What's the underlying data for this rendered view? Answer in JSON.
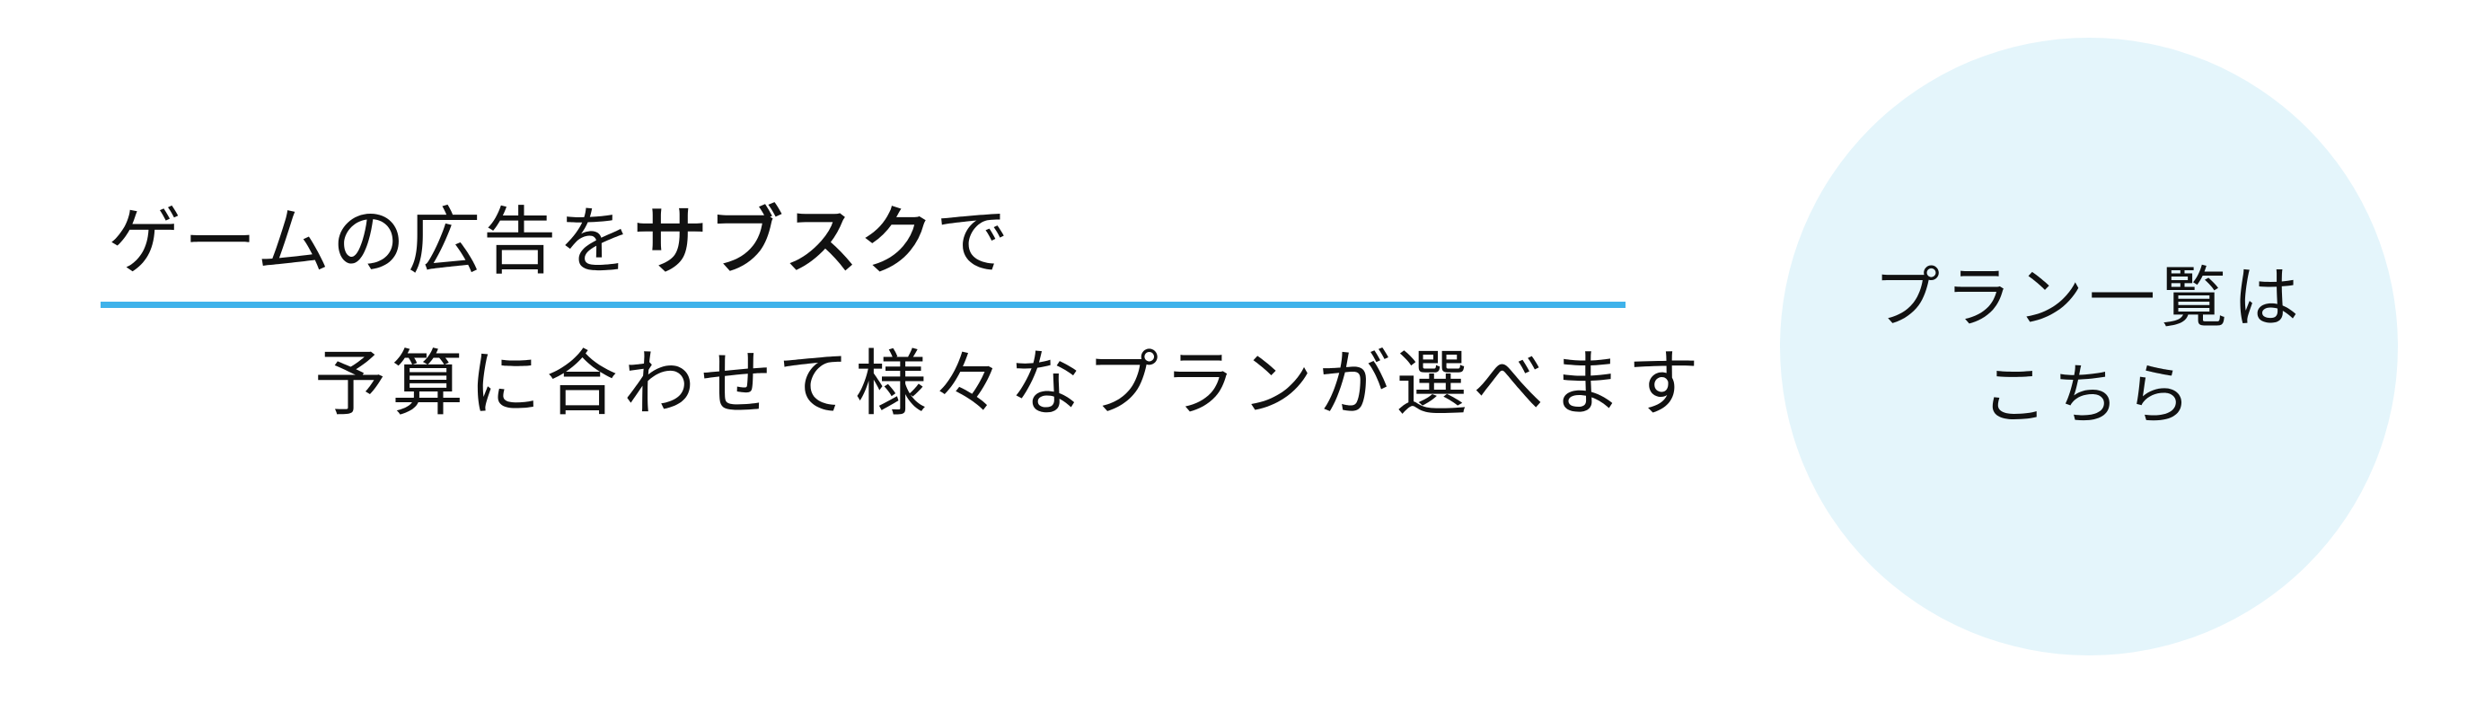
{
  "banner": {
    "headline_prefix": "ゲームの広告を",
    "headline_emphasis": "サブスク",
    "headline_suffix": "で",
    "subline": "予算に合わせて様々なプランが選べます",
    "accent_color": "#3fb2ea"
  },
  "plan_button": {
    "line1": "プラン一覧は",
    "line2": "こちら",
    "background_color": "#e4f5fb"
  }
}
